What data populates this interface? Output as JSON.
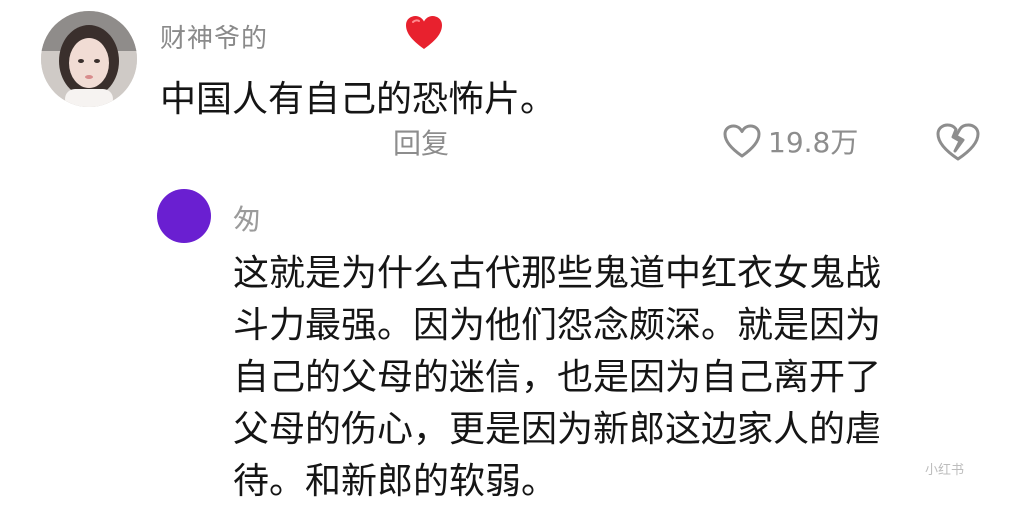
{
  "comment": {
    "username": "财神爷的",
    "text": "中国人有自己的恐怖片。",
    "reply_label": "回复",
    "like_count": "19.8万",
    "icons": {
      "avatar": "woman-portrait-avatar",
      "name_emoji": "red-heart-emoji-icon",
      "like": "heart-outline-icon",
      "dislike": "broken-heart-icon"
    }
  },
  "reply": {
    "username": "匆",
    "avatar_color": "#6a1fd1",
    "lines": [
      "这就是为什么古代那些鬼道中红衣女鬼战",
      "斗力最强。因为他们怨念颇深。就是因为",
      "自己的父母的迷信，也是因为自己离开了",
      "父母的伤心，更是因为新郎这边家人的虐",
      "待。和新郎的软弱。"
    ]
  },
  "watermark": "小红书"
}
